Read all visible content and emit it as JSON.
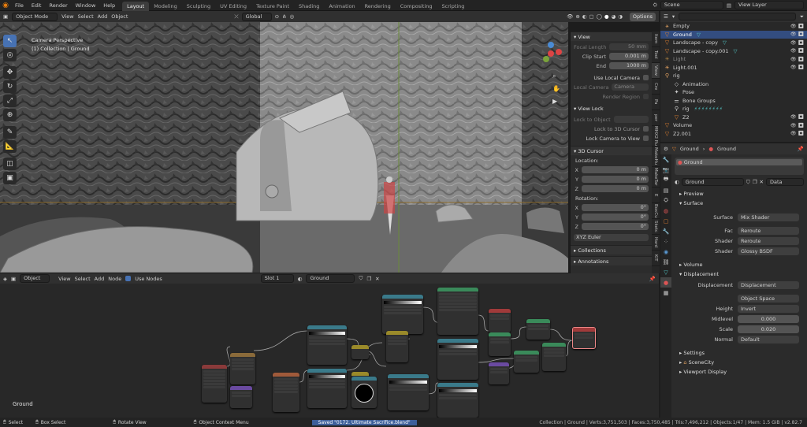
{
  "topbar": {
    "menus": [
      "File",
      "Edit",
      "Render",
      "Window",
      "Help"
    ],
    "workspaces": [
      "Layout",
      "Modeling",
      "Sculpting",
      "UV Editing",
      "Texture Paint",
      "Shading",
      "Animation",
      "Rendering",
      "Compositing",
      "Scripting"
    ],
    "active_workspace": "Layout",
    "scene": "Scene",
    "view_layer": "View Layer"
  },
  "viewport_header": {
    "mode": "Object Mode",
    "menus": [
      "View",
      "Select",
      "Add",
      "Object"
    ],
    "orientation": "Global",
    "options": "Options"
  },
  "viewport": {
    "camera_label": "Camera Perspective",
    "collection_label": "(1) Collection | Ground"
  },
  "npanel": {
    "view_title": "View",
    "focal_length_label": "Focal Length",
    "focal_length": "50 mm",
    "clip_start_label": "Clip Start",
    "clip_start": "0.001 m",
    "end_label": "End",
    "end": "1000 m",
    "use_local_camera": "Use Local Camera",
    "local_camera_label": "Local Camera",
    "local_camera": "Camera",
    "render_region": "Render Region",
    "view_lock_title": "View Lock",
    "lock_to_object": "Lock to Object",
    "lock_to_3d_cursor": "Lock to 3D Cursor",
    "lock_camera_to_view": "Lock Camera to View",
    "cursor_title": "3D Cursor",
    "location_label": "Location:",
    "x_label": "X",
    "y_label": "Y",
    "z_label": "Z",
    "loc_x": "0 m",
    "loc_y": "0 m",
    "loc_z": "0 m",
    "rotation_label": "Rotation:",
    "rot_x": "0°",
    "rot_y": "0°",
    "rot_z": "0°",
    "rotation_mode": "XYZ Euler",
    "collections": "Collections",
    "annotations": "Annotations",
    "tabs": [
      "Item",
      "Tool",
      "View",
      "Cre",
      "Pa",
      "per",
      "MHX2 Ru",
      "MakeHu",
      "MakeTar",
      "E",
      "BoxCu",
      "Sketc",
      "Hard",
      "KIT"
    ]
  },
  "node_header": {
    "editor": "Object",
    "menus": [
      "View",
      "Select",
      "Add",
      "Node"
    ],
    "use_nodes": "Use Nodes",
    "slot": "Slot 1",
    "material": "Ground"
  },
  "node_editor": {
    "material_label": "Ground"
  },
  "outliner": {
    "search_placeholder": "",
    "items": [
      {
        "name": "Empty",
        "icon": "empty-icon",
        "color": "#e0a060",
        "indent": 0
      },
      {
        "name": "Ground",
        "icon": "mesh-icon",
        "color": "#e08030",
        "indent": 0,
        "selected": true
      },
      {
        "name": "Landscape - copy",
        "icon": "mesh-icon",
        "color": "#e08030",
        "indent": 0
      },
      {
        "name": "Landscape - copy.001",
        "icon": "mesh-icon",
        "color": "#e08030",
        "indent": 0
      },
      {
        "name": "Light",
        "icon": "light-icon",
        "color": "#e0a060",
        "indent": 0,
        "dim": true
      },
      {
        "name": "Light.001",
        "icon": "light-icon",
        "color": "#e0a060",
        "indent": 0
      },
      {
        "name": "rig",
        "icon": "armature-icon",
        "color": "#e0a060",
        "indent": 0
      },
      {
        "name": "Animation",
        "icon": "animation-icon",
        "color": "#cfcfcf",
        "indent": 1
      },
      {
        "name": "Pose",
        "icon": "pose-icon",
        "color": "#cfcfcf",
        "indent": 1
      },
      {
        "name": "Bone Groups",
        "icon": "bone-icon",
        "color": "#cfcfcf",
        "indent": 1
      },
      {
        "name": "rig",
        "icon": "armature-icon",
        "color": "#cfcfcf",
        "indent": 1
      },
      {
        "name": "Z2",
        "icon": "mesh-icon",
        "color": "#e08030",
        "indent": 1
      },
      {
        "name": "Volume",
        "icon": "mesh-icon",
        "color": "#e08030",
        "indent": 0
      },
      {
        "name": "Z2.001",
        "icon": "mesh-icon",
        "color": "#e08030",
        "indent": 0
      }
    ]
  },
  "properties": {
    "object_name": "Ground",
    "material_name": "Ground",
    "slot_name": "Ground",
    "material_field": "Ground",
    "data_mode": "Data",
    "preview": "Preview",
    "surface": "Surface",
    "surface_label": "Surface",
    "surface_value": "Mix Shader",
    "fac_label": "Fac",
    "fac_value": "Reroute",
    "shader1_label": "Shader",
    "shader1_value": "Reroute",
    "shader2_label": "Shader",
    "shader2_value": "Glossy BSDF",
    "volume": "Volume",
    "displacement_section": "Displacement",
    "displacement_label": "Displacement",
    "displacement_value": "Displacement",
    "space_value": "Object Space",
    "height_label": "Height",
    "height_value": "Invert",
    "midlevel_label": "Midlevel",
    "midlevel_value": "0.000",
    "scale_label": "Scale",
    "scale_value": "0.020",
    "normal_label": "Normal",
    "normal_value": "Default",
    "settings": "Settings",
    "scenecity": "SceneCity",
    "viewport_display": "Viewport Display"
  },
  "statusbar": {
    "select": "Select",
    "box_select": "Box Select",
    "rotate_view": "Rotate View",
    "context_menu": "Object Context Menu",
    "saved": "Saved \"0172. Ultimate Sacrifice.blend\"",
    "stats": "Collection | Ground | Verts:3,751,503 | Faces:3,750,485 | Tris:7,496,212 | Objects:1/47 | Mem: 1.5 GiB | v2.82.7"
  },
  "colors": {
    "accent": "#4772b3",
    "selection": "#334d80",
    "background": "#1d1d1d"
  }
}
